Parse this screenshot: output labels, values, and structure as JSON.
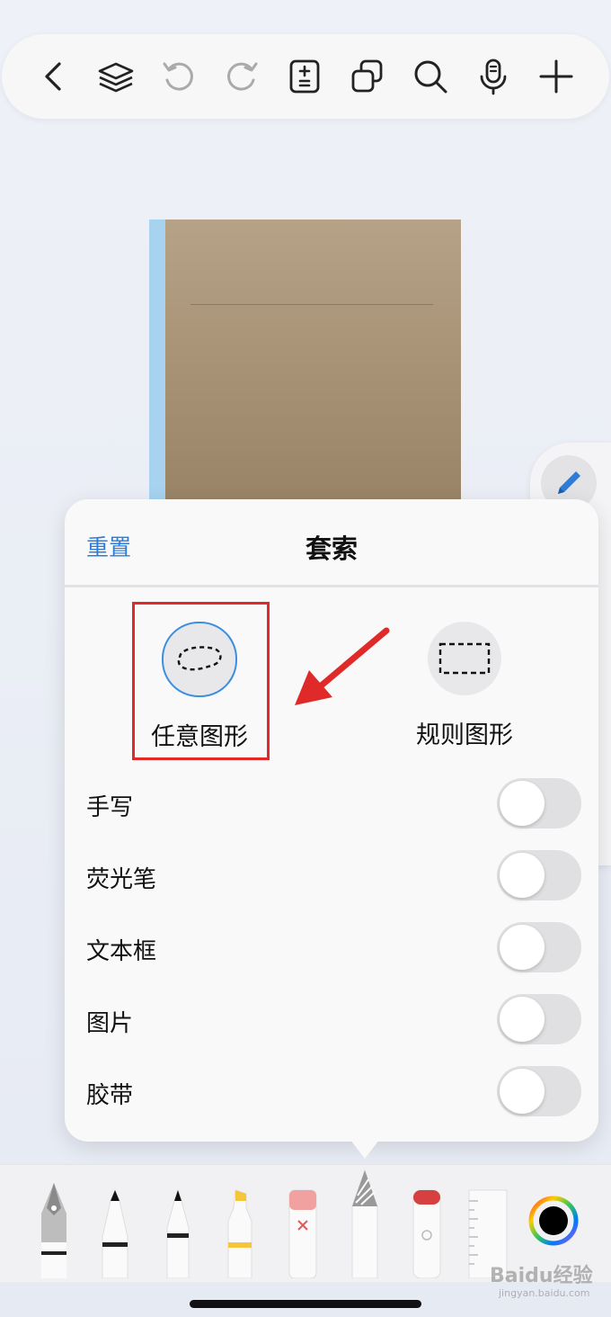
{
  "toolbar": {
    "items": [
      {
        "name": "back-icon"
      },
      {
        "name": "layers-icon"
      },
      {
        "name": "undo-icon"
      },
      {
        "name": "redo-icon"
      },
      {
        "name": "page-adjust-icon"
      },
      {
        "name": "copy-icon"
      },
      {
        "name": "search-icon"
      },
      {
        "name": "microphone-icon"
      },
      {
        "name": "add-icon"
      }
    ]
  },
  "popover": {
    "reset_label": "重置",
    "title": "套索",
    "shapes": [
      {
        "label": "任意图形",
        "icon": "freeform-lasso-icon",
        "selected": true
      },
      {
        "label": "规则图形",
        "icon": "rectangle-lasso-icon",
        "selected": false
      }
    ],
    "options": [
      {
        "label": "手写",
        "on": false
      },
      {
        "label": "荧光笔",
        "on": false
      },
      {
        "label": "文本框",
        "on": false
      },
      {
        "label": "图片",
        "on": false
      },
      {
        "label": "胶带",
        "on": false
      }
    ]
  },
  "tools": [
    {
      "name": "fountain-pen-icon"
    },
    {
      "name": "pen-icon"
    },
    {
      "name": "fineliner-icon"
    },
    {
      "name": "highlighter-icon"
    },
    {
      "name": "eraser-icon"
    },
    {
      "name": "lasso-tool-icon",
      "selected": true
    },
    {
      "name": "tape-icon"
    },
    {
      "name": "ruler-icon"
    },
    {
      "name": "color-picker-icon"
    }
  ],
  "colors": {
    "accent": "#2e7cd6",
    "highlight": "#e02a2a",
    "selected_color": "#000000"
  },
  "watermark": {
    "text": "Baidu经验",
    "sub": "jingyan.baidu.com"
  }
}
